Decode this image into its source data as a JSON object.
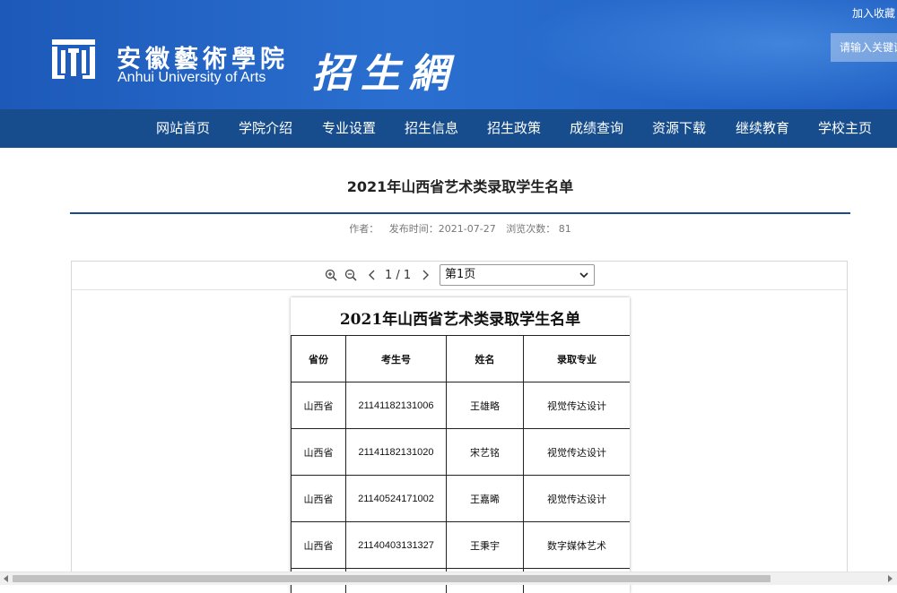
{
  "header": {
    "logo_cn": "安徽藝術學院",
    "logo_en": "Anhui University of Arts",
    "site_title": "招生網",
    "favorite_link": "加入收藏",
    "search_placeholder": "请输入关键词"
  },
  "nav": {
    "items": [
      {
        "label": "网站首页"
      },
      {
        "label": "学院介绍"
      },
      {
        "label": "专业设置"
      },
      {
        "label": "招生信息"
      },
      {
        "label": "招生政策"
      },
      {
        "label": "成绩查询"
      },
      {
        "label": "资源下载"
      },
      {
        "label": "继续教育"
      },
      {
        "label": "学校主页"
      }
    ]
  },
  "article": {
    "title": "2021年山西省艺术类录取学生名单",
    "author_label": "作者：",
    "publish_label": "发布时间：2021-07-27",
    "views_label": "浏览次数：",
    "views_count": "81"
  },
  "viewer": {
    "page_indicator": "1 / 1",
    "page_select": "第1页",
    "zoom_in_icon": "zoom-in-icon",
    "zoom_out_icon": "zoom-out-icon"
  },
  "document": {
    "title": "2021年山西省艺术类录取学生名单",
    "headers": [
      "省份",
      "考生号",
      "姓名",
      "录取专业"
    ],
    "rows": [
      [
        "山西省",
        "21141182131006",
        "王雄略",
        "视觉传达设计"
      ],
      [
        "山西省",
        "21141182131020",
        "宋艺铭",
        "视觉传达设计"
      ],
      [
        "山西省",
        "21140524171002",
        "王嘉晞",
        "视觉传达设计"
      ],
      [
        "山西省",
        "21140403131327",
        "王秉宇",
        "数字媒体艺术"
      ],
      [
        "",
        "",
        "",
        ""
      ]
    ]
  },
  "colors": {
    "header_blue": "#2a6fd0",
    "nav_blue": "#174d8c"
  }
}
